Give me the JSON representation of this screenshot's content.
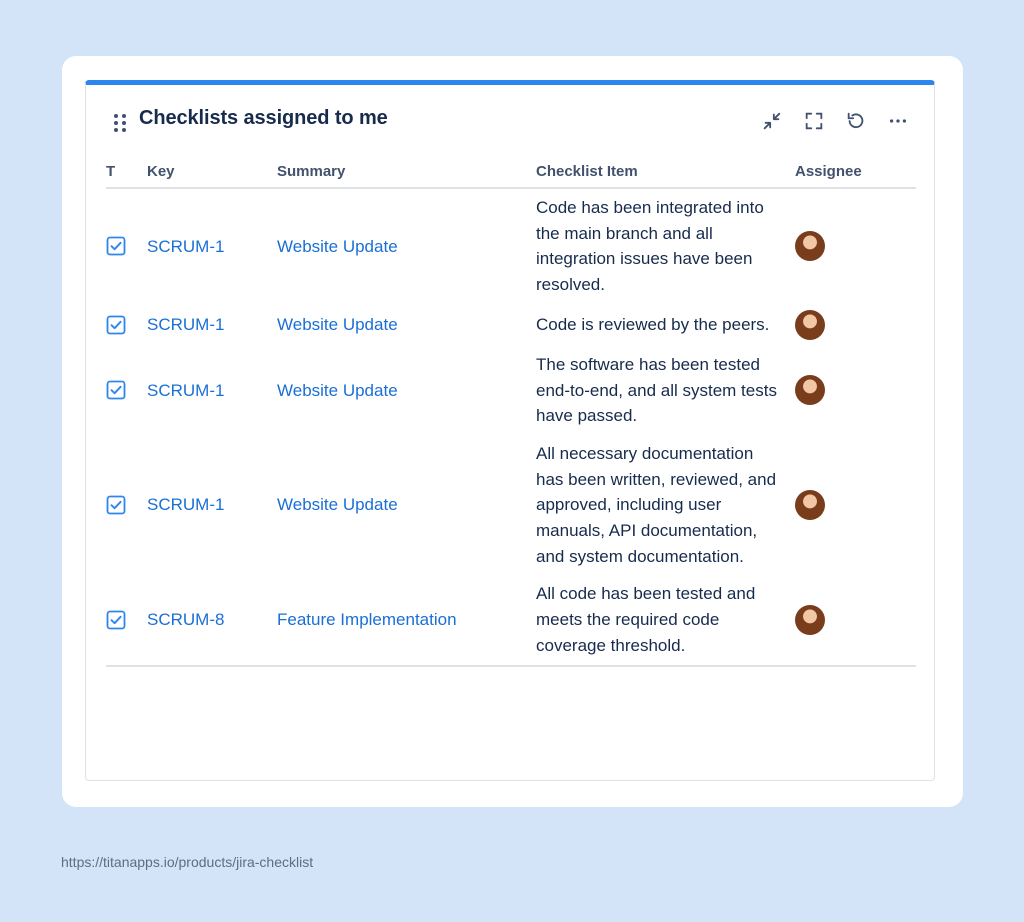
{
  "gadget": {
    "title": "Checklists assigned to me",
    "accent_color": "#2d86f0",
    "actions": [
      "collapse-icon",
      "fullscreen-icon",
      "refresh-icon",
      "more-icon"
    ]
  },
  "table": {
    "columns": [
      "T",
      "Key",
      "Summary",
      "Checklist Item",
      "Assignee"
    ],
    "rows": [
      {
        "type_icon": "task-checkbox-icon",
        "key": "SCRUM-1",
        "summary": "Website Update",
        "item": "Code has been integrated into the main branch and all integration issues have been resolved.",
        "assignee_avatar": "avatar"
      },
      {
        "type_icon": "task-checkbox-icon",
        "key": "SCRUM-1",
        "summary": "Website Update",
        "item": "Code is reviewed by the peers.",
        "assignee_avatar": "avatar"
      },
      {
        "type_icon": "task-checkbox-icon",
        "key": "SCRUM-1",
        "summary": "Website Update",
        "item": "The software has been tested end-to-end, and all system tests have passed.",
        "assignee_avatar": "avatar"
      },
      {
        "type_icon": "task-checkbox-icon",
        "key": "SCRUM-1",
        "summary": "Website Update",
        "item": "All necessary documentation has been written, reviewed, and approved, including user manuals, API documentation, and system documentation.",
        "assignee_avatar": "avatar"
      },
      {
        "type_icon": "task-checkbox-icon",
        "key": "SCRUM-8",
        "summary": "Feature Implementation",
        "item": "All code has been tested and meets the required code coverage threshold.",
        "assignee_avatar": "avatar"
      }
    ]
  },
  "footer": {
    "url": "https://titanapps.io/products/jira-checklist"
  }
}
